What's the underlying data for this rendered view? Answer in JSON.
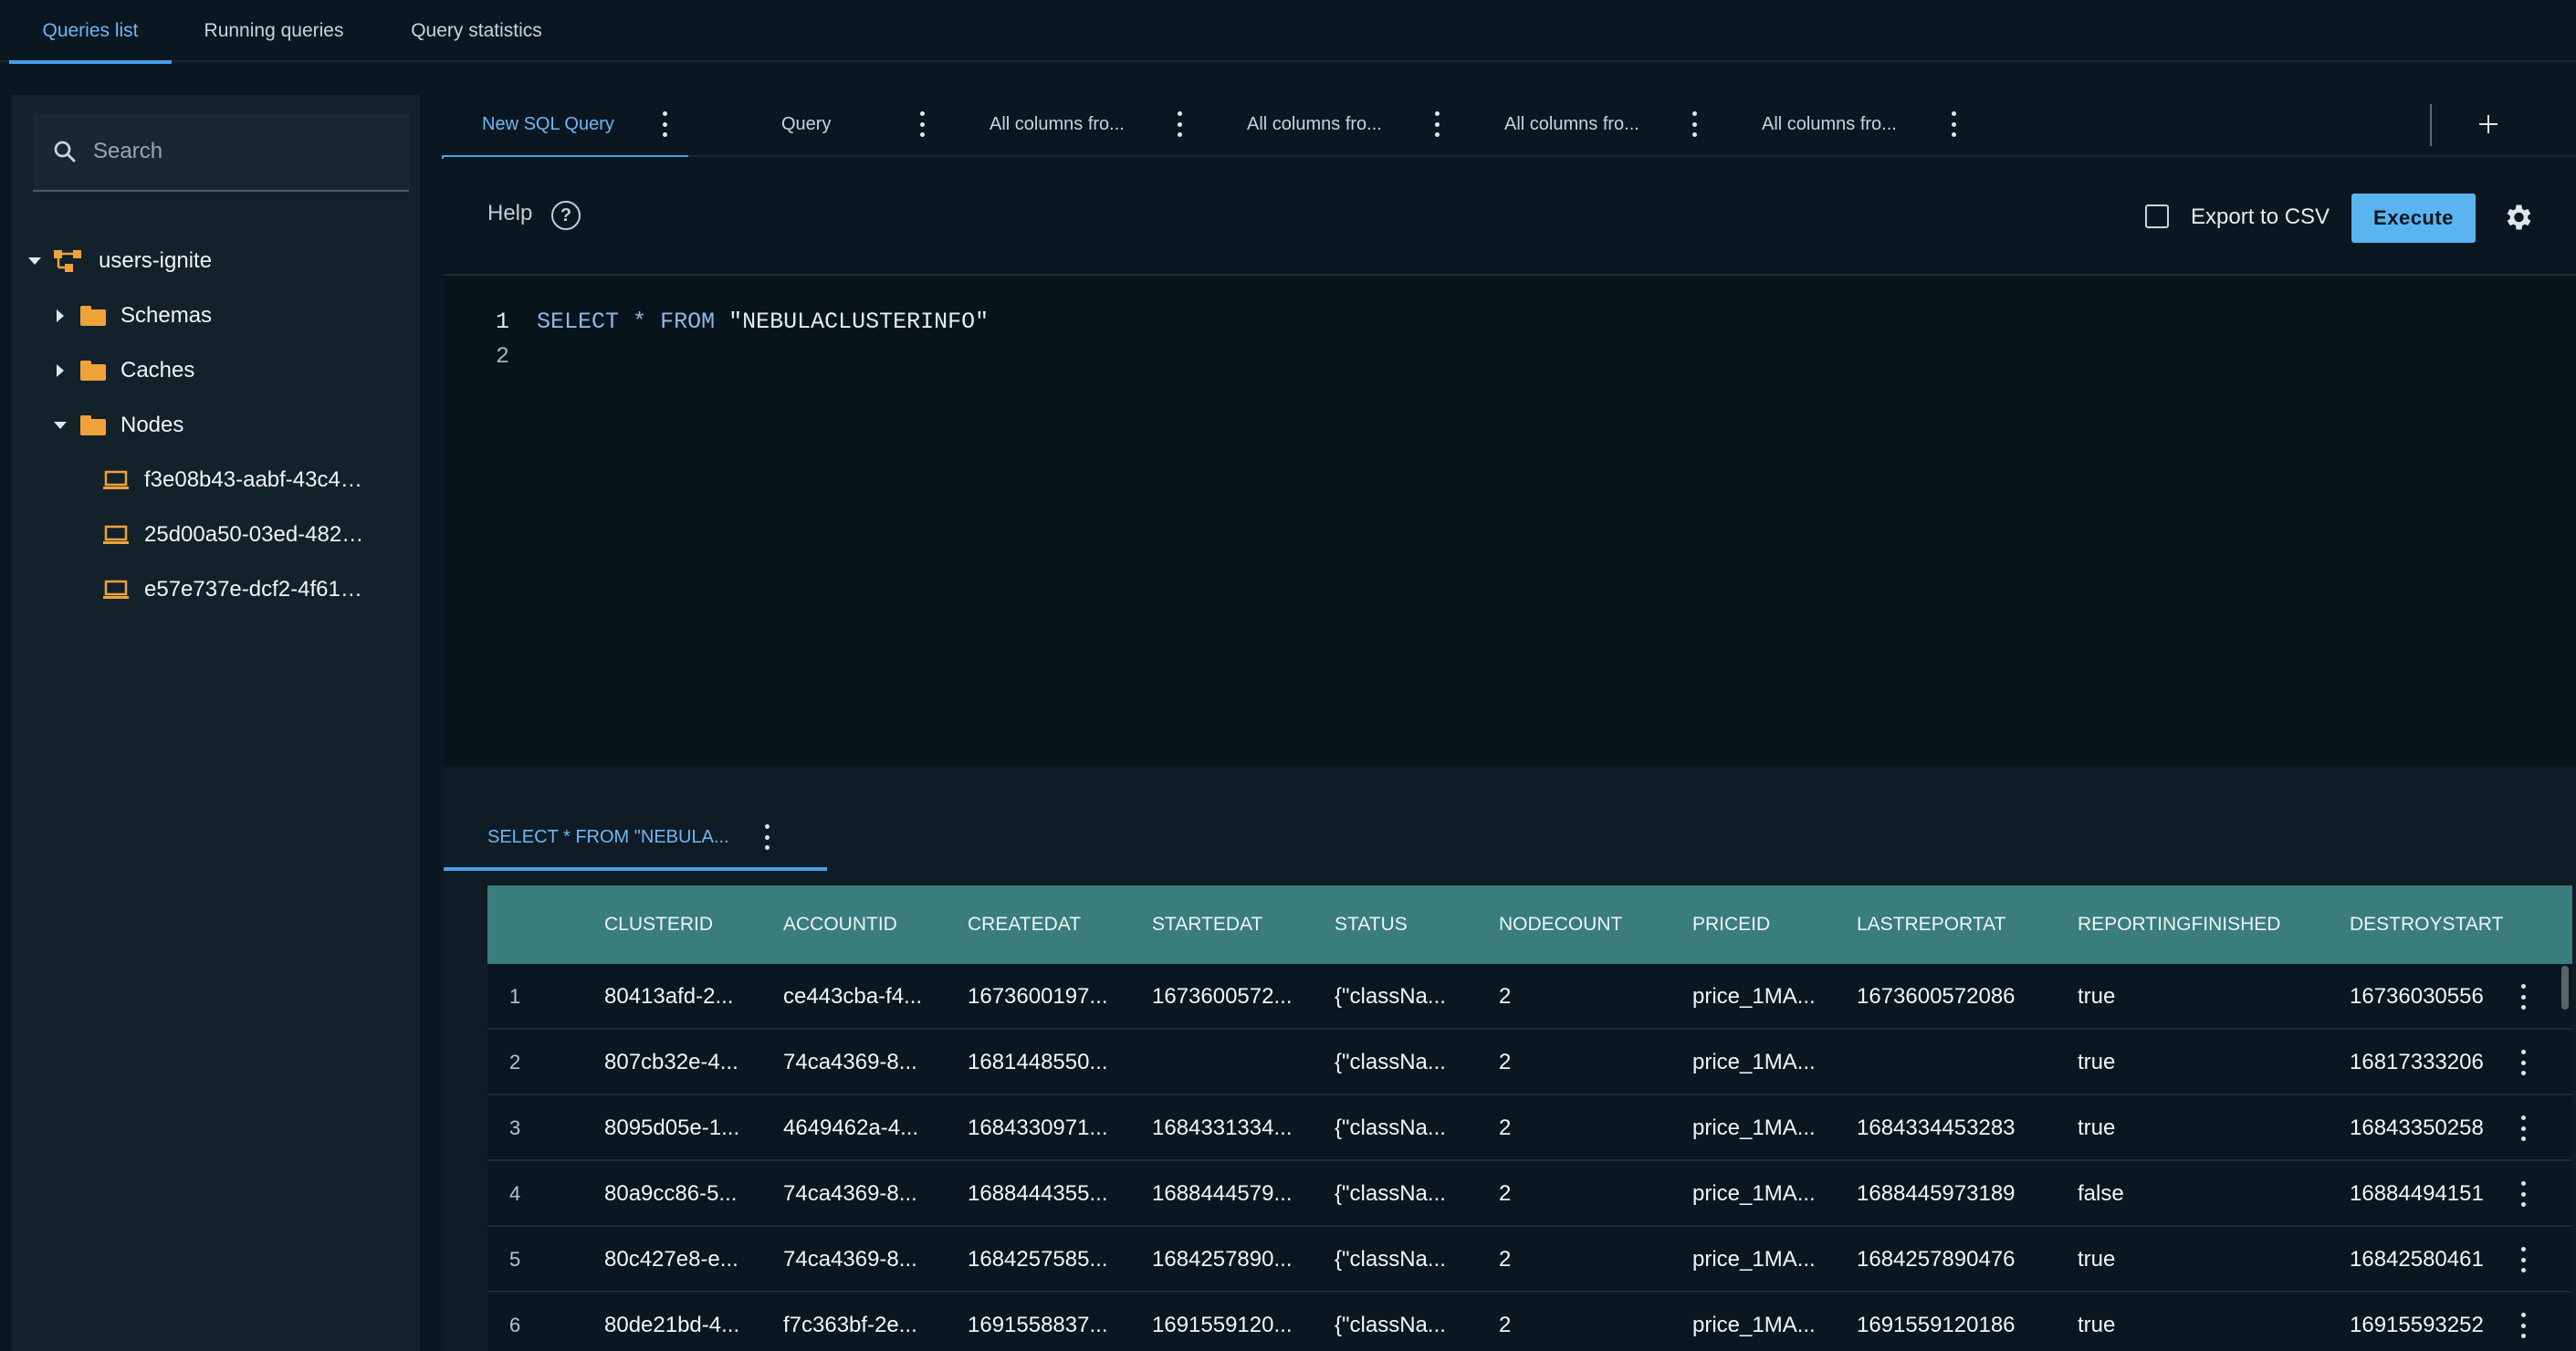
{
  "top_tabs": [
    {
      "label": "Queries list",
      "active": true
    },
    {
      "label": "Running queries",
      "active": false
    },
    {
      "label": "Query statistics",
      "active": false
    }
  ],
  "sidebar": {
    "search_placeholder": "Search",
    "tree": {
      "root": "users-ignite",
      "schemas": "Schemas",
      "caches": "Caches",
      "nodes": "Nodes",
      "node_items": [
        "f3e08b43-aabf-43c4…",
        "25d00a50-03ed-482…",
        "e57e737e-dcf2-4f61…"
      ]
    }
  },
  "query_tabs": [
    {
      "label": "New SQL Query",
      "active": true
    },
    {
      "label": "Query",
      "active": false
    },
    {
      "label": "All columns fro...",
      "active": false
    },
    {
      "label": "All columns fro...",
      "active": false
    },
    {
      "label": "All columns fro...",
      "active": false
    },
    {
      "label": "All columns fro...",
      "active": false
    }
  ],
  "toolbar": {
    "help_label": "Help",
    "export_label": "Export to CSV",
    "execute_label": "Execute"
  },
  "editor": {
    "line_numbers": [
      "1",
      "2"
    ],
    "kw_select": "SELECT",
    "star": "*",
    "kw_from": "FROM",
    "table": "\"NEBULACLUSTERINFO\""
  },
  "results": {
    "tab_label": "SELECT * FROM \"NEBULA...",
    "columns": [
      "CLUSTERID",
      "ACCOUNTID",
      "CREATEDAT",
      "STARTEDAT",
      "STATUS",
      "NODECOUNT",
      "PRICEID",
      "LASTREPORTAT",
      "REPORTINGFINISHED",
      "DESTROYSTART"
    ],
    "rows": [
      [
        "1",
        "80413afd-2...",
        "ce443cba-f4...",
        "1673600197...",
        "1673600572...",
        "{\"classNa...",
        "2",
        "price_1MA...",
        "1673600572086",
        "true",
        "16736030556"
      ],
      [
        "2",
        "807cb32e-4...",
        "74ca4369-8...",
        "1681448550...",
        "",
        "{\"classNa...",
        "2",
        "price_1MA...",
        "",
        "true",
        "16817333206"
      ],
      [
        "3",
        "8095d05e-1...",
        "4649462a-4...",
        "1684330971...",
        "1684331334...",
        "{\"classNa...",
        "2",
        "price_1MA...",
        "1684334453283",
        "true",
        "16843350258"
      ],
      [
        "4",
        "80a9cc86-5...",
        "74ca4369-8...",
        "1688444355...",
        "1688444579...",
        "{\"classNa...",
        "2",
        "price_1MA...",
        "1688445973189",
        "false",
        "16884494151"
      ],
      [
        "5",
        "80c427e8-e...",
        "74ca4369-8...",
        "1684257585...",
        "1684257890...",
        "{\"classNa...",
        "2",
        "price_1MA...",
        "1684257890476",
        "true",
        "16842580461"
      ],
      [
        "6",
        "80de21bd-4...",
        "f7c363bf-2e...",
        "1691558837...",
        "1691559120...",
        "{\"classNa...",
        "2",
        "price_1MA...",
        "1691559120186",
        "true",
        "16915593252"
      ]
    ]
  },
  "colors": {
    "accent": "#4a9ee8",
    "execute_bg": "#5ab4f0",
    "header_bg": "#3a7d7d",
    "folder": "#f0a23a"
  }
}
